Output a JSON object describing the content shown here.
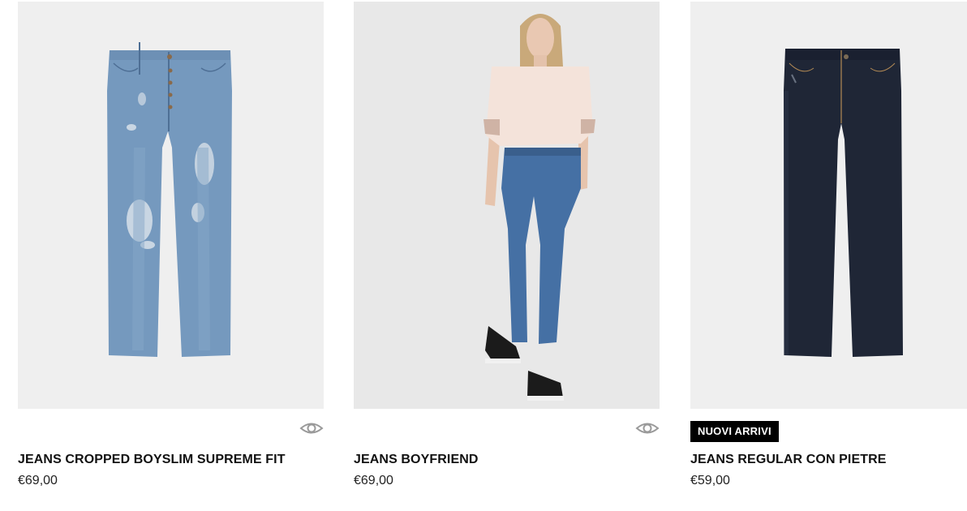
{
  "products": [
    {
      "title": "JEANS CROPPED BOYSLIM SUPREME FIT",
      "price": "€69,00",
      "image": "light-blue-distressed-jeans",
      "quickview_icon": "eye-icon"
    },
    {
      "title": "JEANS BOYFRIEND",
      "price": "€69,00",
      "image": "model-wearing-boyfriend-jeans",
      "quickview_icon": "eye-icon"
    },
    {
      "title": "JEANS REGULAR CON PIETRE",
      "price": "€59,00",
      "image": "dark-rinse-regular-jeans",
      "badge": "NUOVI ARRIVI"
    }
  ],
  "colors": {
    "background": "#ffffff",
    "image_bg": "#efefef",
    "badge_bg": "#000000",
    "text": "#111111",
    "light_denim": "#6f93b8",
    "mid_denim": "#3f6a9e",
    "dark_denim": "#1e2535"
  }
}
